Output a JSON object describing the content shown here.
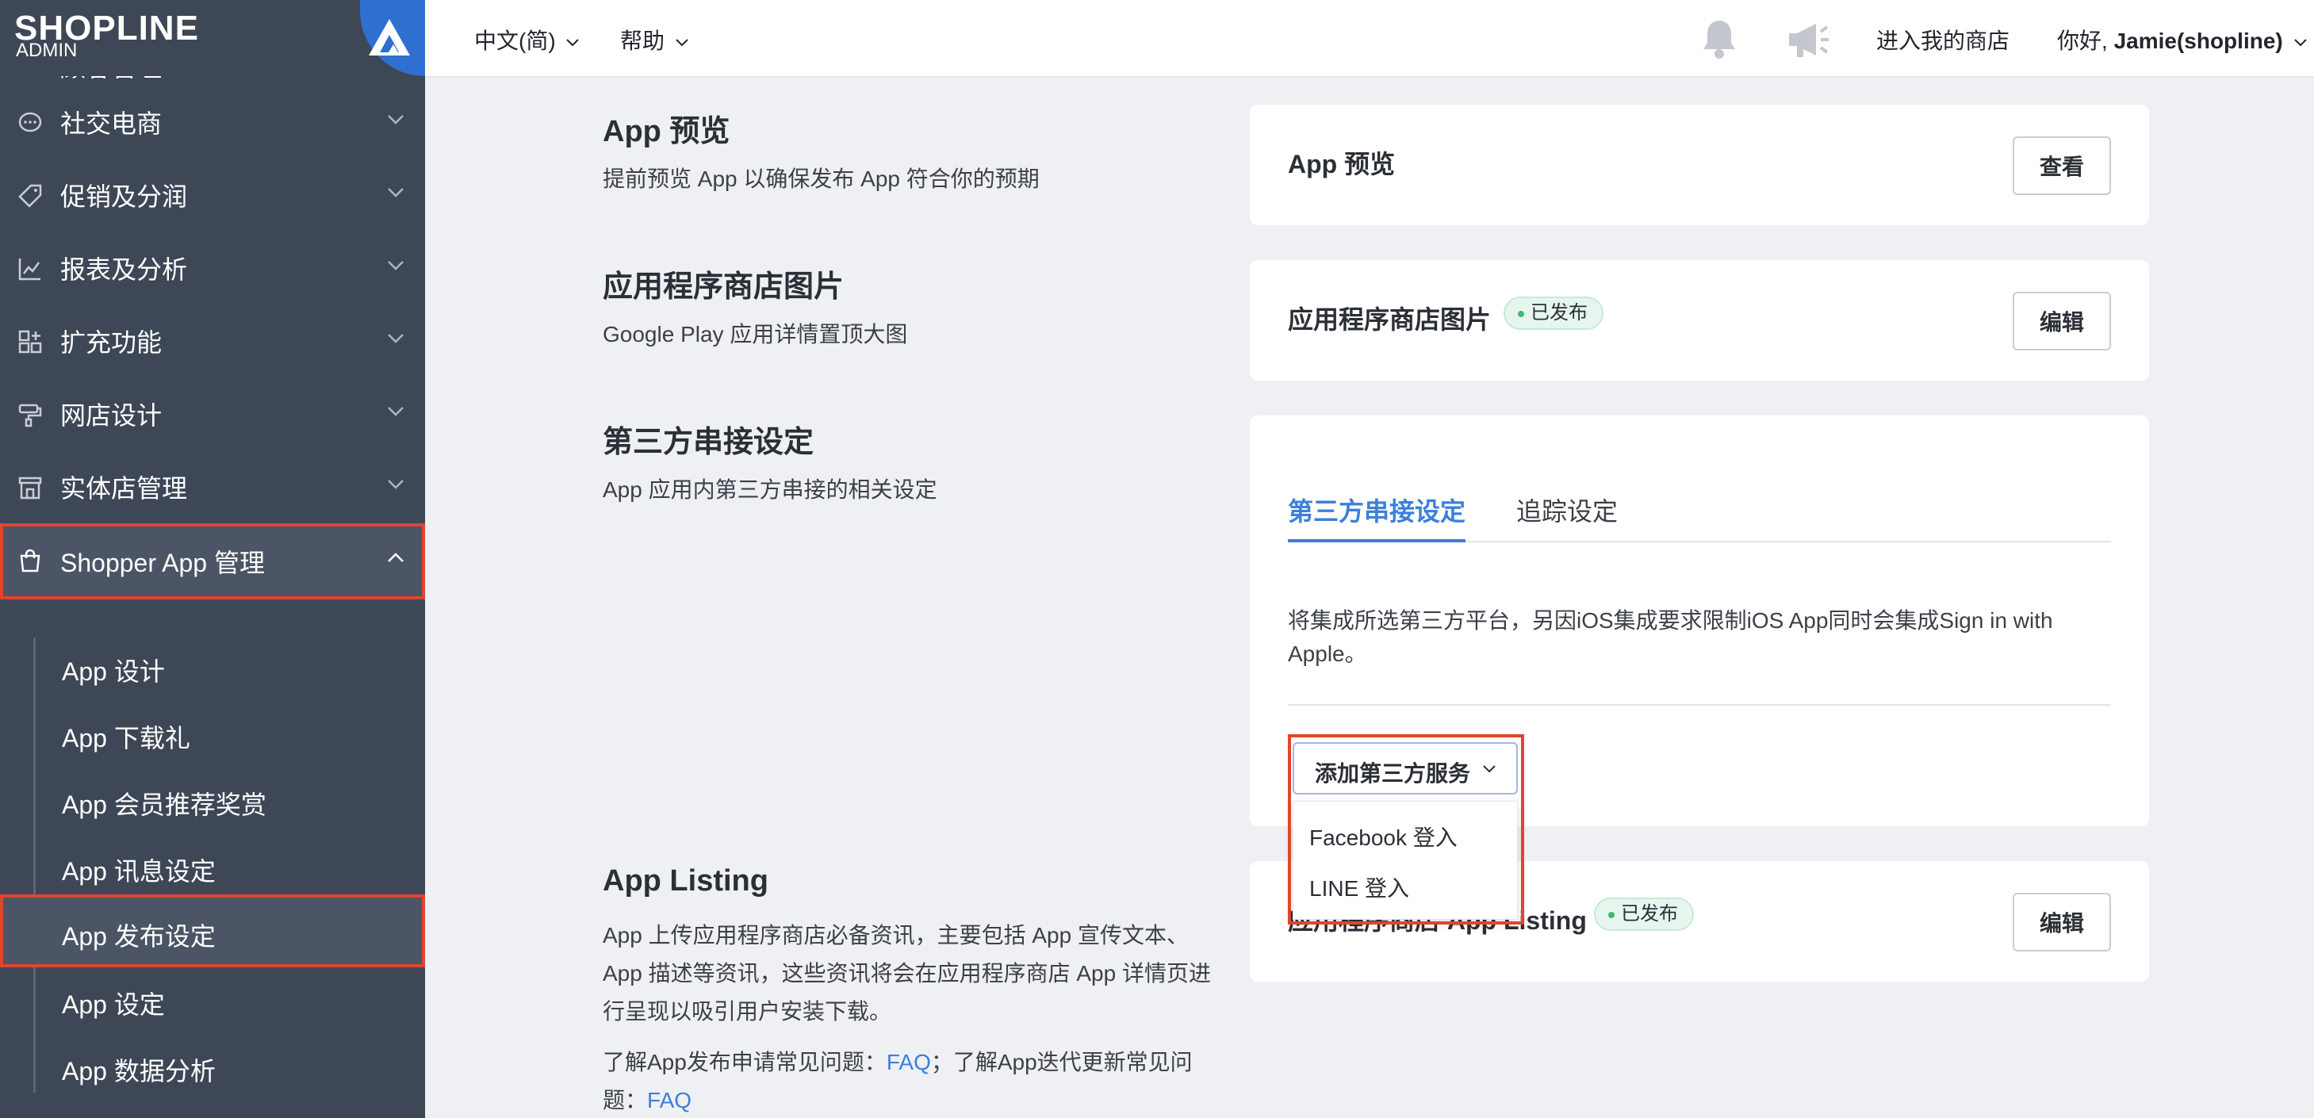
{
  "brand": {
    "logo": "SHOPLINE",
    "sub": "ADMIN"
  },
  "sidebar": {
    "items": [
      {
        "label": "顾客管理",
        "icon": "customer-icon"
      },
      {
        "label": "社交电商",
        "icon": "chat-icon"
      },
      {
        "label": "促销及分润",
        "icon": "tag-icon"
      },
      {
        "label": "报表及分析",
        "icon": "chart-icon"
      },
      {
        "label": "扩充功能",
        "icon": "apps-icon"
      },
      {
        "label": "网店设计",
        "icon": "brush-icon"
      },
      {
        "label": "实体店管理",
        "icon": "store-icon"
      },
      {
        "label": "Shopper App 管理",
        "icon": "bag-icon",
        "expanded": true
      }
    ],
    "sub_items": [
      {
        "label": "App 设计"
      },
      {
        "label": "App 下载礼"
      },
      {
        "label": "App 会员推荐奖赏"
      },
      {
        "label": "App 讯息设定"
      },
      {
        "label": "App 发布设定",
        "active": true
      },
      {
        "label": "App 设定"
      },
      {
        "label": "App 数据分析"
      }
    ]
  },
  "topbar": {
    "language": "中文(简)",
    "help": "帮助",
    "enter_store": "进入我的商店",
    "greeting_prefix": "你好, ",
    "user_name": "Jamie(shopline)"
  },
  "sections": {
    "preview": {
      "title": "App 预览",
      "desc": "提前预览 App 以确保发布 App 符合你的预期",
      "card_title": "App 预览",
      "button": "查看"
    },
    "store_images": {
      "title": "应用程序商店图片",
      "desc": "Google Play 应用详情置顶大图",
      "card_title": "应用程序商店图片",
      "badge": "已发布",
      "button": "编辑"
    },
    "third_party": {
      "title": "第三方串接设定",
      "desc": "App 应用内第三方串接的相关设定",
      "tabs": [
        "第三方串接设定",
        "追踪设定"
      ],
      "text": "将集成所选第三方平台，另因iOS集成要求限制iOS App同时会集成Sign in with Apple。",
      "dropdown_label": "添加第三方服务",
      "dropdown_options": [
        "Facebook 登入",
        "LINE 登入"
      ]
    },
    "listing": {
      "title": "App Listing",
      "desc": "App 上传应用程序商店必备资讯，主要包括 App 宣传文本、App 描述等资讯，这些资讯将会在应用程序商店 App 详情页进行呈现以吸引用户安装下载。",
      "faq_prefix1": "了解App发布申请常见问题：",
      "faq_link1": "FAQ",
      "faq_prefix2": "；了解App迭代更新常见问题：",
      "faq_link2": "FAQ",
      "card_title": "应用程序商店 App Listing",
      "badge": "已发布",
      "button": "编辑"
    }
  },
  "colors": {
    "sidebar": "#3d4756",
    "accent": "#3d7fd9",
    "highlight": "#e0452e"
  }
}
